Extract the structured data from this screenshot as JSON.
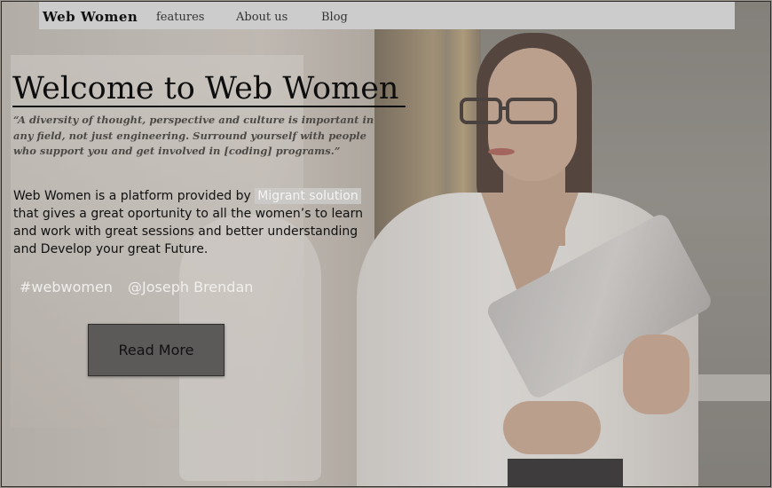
{
  "nav": {
    "brand": "Web Women",
    "links": [
      {
        "label": "features"
      },
      {
        "label": "About us"
      },
      {
        "label": "Blog"
      }
    ]
  },
  "hero": {
    "title": "Welcome to Web Women",
    "quote": "“A diversity of thought, perspective and culture is important in any field, not just engineering. Surround yourself with people who support you and get involved in [coding] programs.”",
    "description_before": "Web Women is a platform provided by ",
    "description_highlight": "Migrant solution",
    "description_after": " that gives a great oportunity to all the women’s to learn and work with great sessions and better understanding and Develop your great Future.",
    "tags": [
      "#webwomen",
      "@Joseph Brendan"
    ],
    "cta_label": "Read More"
  },
  "colors": {
    "navbar_bg": "#cdcccc",
    "button_bg": "#5c5a59",
    "highlight_bg": "#cdcbc9"
  }
}
